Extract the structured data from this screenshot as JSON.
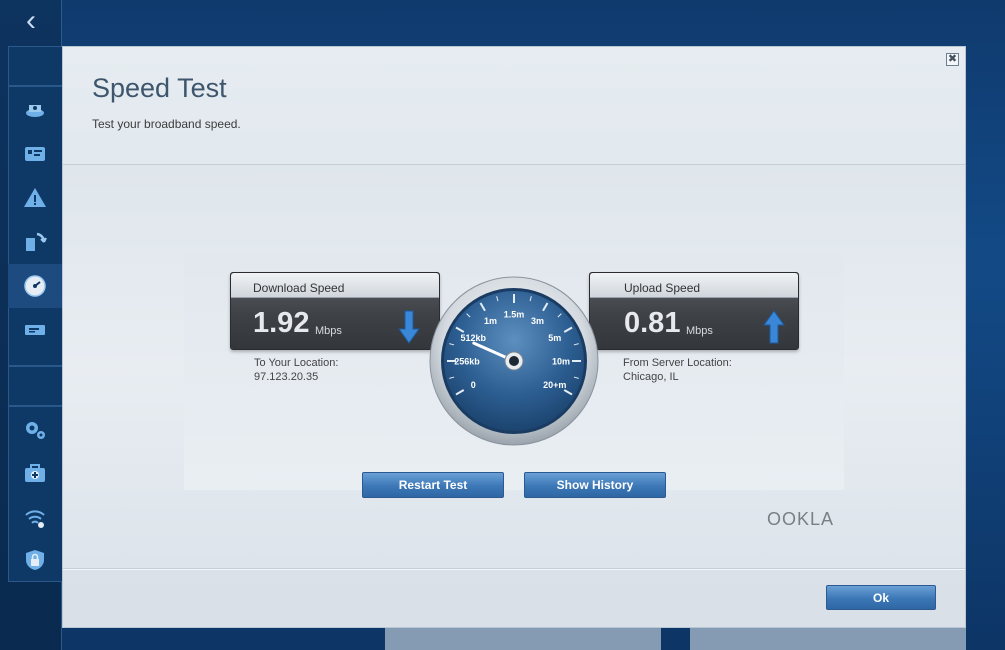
{
  "modal": {
    "title": "Speed Test",
    "subtitle": "Test your broadband speed.",
    "close_glyph": "✖",
    "ok_label": "Ok"
  },
  "download": {
    "heading": "Download Speed",
    "value": "1.92",
    "unit": "Mbps",
    "location_label": "To Your Location:",
    "location_value": "97.123.20.35"
  },
  "upload": {
    "heading": "Upload Speed",
    "value": "0.81",
    "unit": "Mbps",
    "location_label": "From Server Location:",
    "location_value": "Chicago, IL"
  },
  "gauge": {
    "ticks": [
      "0",
      "256kb",
      "512kb",
      "1m",
      "1.5m",
      "3m",
      "5m",
      "10m",
      "20+m"
    ],
    "needle_tick_position": 1.8
  },
  "buttons": {
    "restart": "Restart Test",
    "history": "Show History"
  },
  "brand": "OOKLA",
  "sidebar": {
    "back_glyph": "‹",
    "items": [
      {
        "icon": "router-icon"
      },
      {
        "icon": "device-list-icon"
      },
      {
        "icon": "warning-icon"
      },
      {
        "icon": "connectivity-icon"
      },
      {
        "icon": "speedometer-icon",
        "active": true
      },
      {
        "icon": "usb-storage-icon"
      },
      {
        "icon": "gear-icon"
      },
      {
        "icon": "troubleshooting-icon"
      },
      {
        "icon": "wireless-icon"
      },
      {
        "icon": "security-lock-icon"
      }
    ]
  },
  "colors": {
    "accent_button": "#3c77b6",
    "title_text": "#3e566d",
    "arrow_blue": "#3a87d8"
  }
}
